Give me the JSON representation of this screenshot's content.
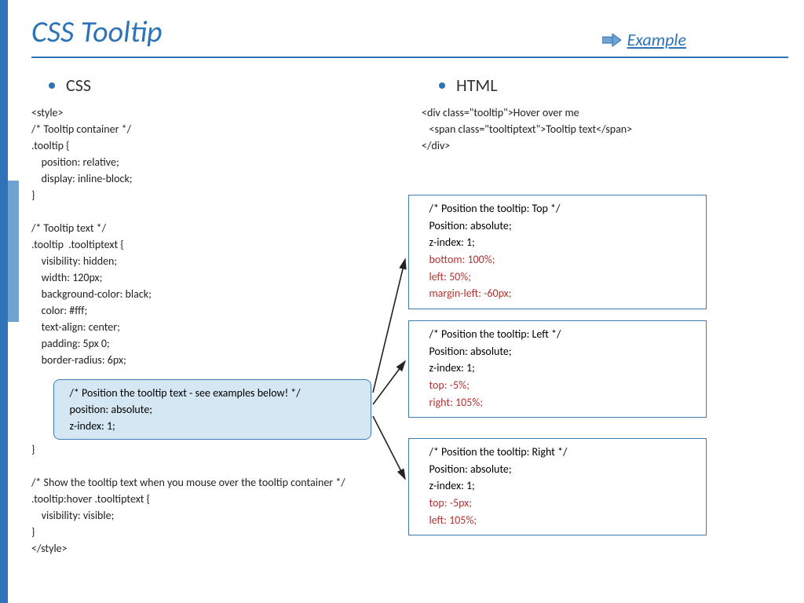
{
  "title": "CSS Tooltip",
  "example_link": "Example",
  "left": {
    "heading": "CSS",
    "l1": "<style>",
    "l2": "/* Tooltip container */",
    "l3": ".tooltip {",
    "l4": "    position: relative;",
    "l5": "    display: inline-block;",
    "l6": "}",
    "l7": "/* Tooltip text */",
    "l8": ".tooltip  .tooltiptext {",
    "l9": "    visibility: hidden;",
    "l10": "    width: 120px;",
    "l11": "    background-color: black;",
    "l12": "    color: #fff;",
    "l13": "    text-align: center;",
    "l14": "    padding: 5px 0;",
    "l15": "    border-radius: 6px;",
    "l16_close": "}",
    "l17": "/* Show the tooltip text when you mouse over the tooltip container */",
    "l18": ".tooltip:hover .tooltiptext {",
    "l19": "    visibility: visible;",
    "l20": "}",
    "l21": "</style>"
  },
  "callout": {
    "c1": "   /* Position the tooltip text - see examples below! */",
    "c2": "   position: absolute;",
    "c3": "   z-index: 1;"
  },
  "right": {
    "heading": "HTML",
    "h1": "<div class=\"tooltip\">Hover over me",
    "h2": "   <span class=\"tooltiptext\">Tooltip text</span>",
    "h3": "</div>"
  },
  "box_top": {
    "t1": "   /* Position the tooltip: Top */",
    "t2": "   Position: absolute;",
    "t3": "   z-index: 1;",
    "t4": "   bottom: 100%;",
    "t5": "   left: 50%;",
    "t6": "   margin-left: -60px;"
  },
  "box_left": {
    "t1": "   /* Position the tooltip: Left */",
    "t2": "   Position: absolute;",
    "t3": "   z-index: 1;",
    "t4": "   top: -5%;",
    "t5": "   right: 105%;"
  },
  "box_right": {
    "t1": "   /* Position the tooltip: Right */",
    "t2": "   Position: absolute;",
    "t3": "   z-index: 1;",
    "t4": "   top: -5px;",
    "t5": "   left: 105%;"
  }
}
